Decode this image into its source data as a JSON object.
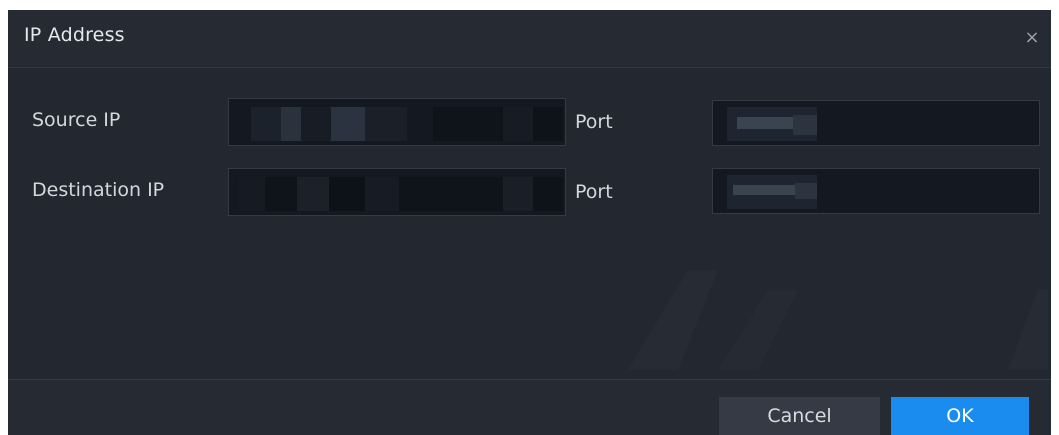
{
  "dialog": {
    "title": "IP Address",
    "close_symbol": "×",
    "rows": [
      {
        "label": "Source IP",
        "port_label": "Port"
      },
      {
        "label": "Destination IP",
        "port_label": "Port"
      }
    ],
    "buttons": {
      "cancel_label": "Cancel",
      "ok_label": "OK"
    }
  },
  "colors": {
    "background": "#23272f",
    "input_bg": "#141821",
    "accent": "#1a8cf0"
  },
  "icons": {
    "close": "close-icon"
  }
}
